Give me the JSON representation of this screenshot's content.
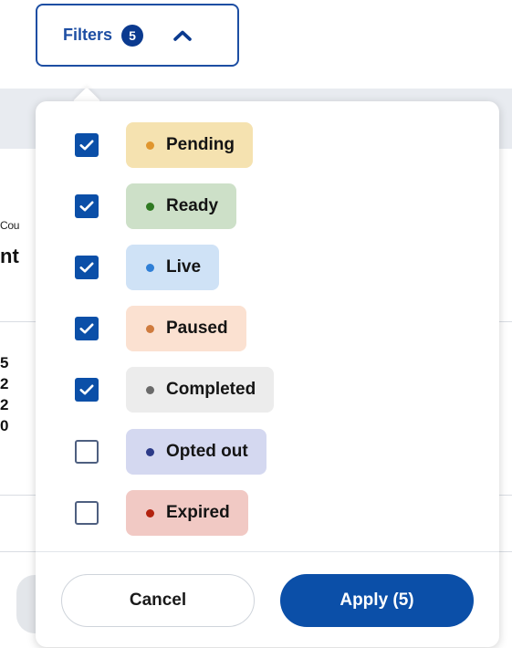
{
  "background": {
    "small_text": "Cou",
    "heading": "nt",
    "numbers": [
      "5",
      "2",
      "2",
      "0"
    ]
  },
  "filters_button": {
    "label": "Filters",
    "count": "5",
    "icon": "chevron-up-icon"
  },
  "options": [
    {
      "label": "Pending",
      "checked": true,
      "chip_color": "#f5e2b0",
      "dot_color": "#e0962e"
    },
    {
      "label": "Ready",
      "checked": true,
      "chip_color": "#cde0c8",
      "dot_color": "#2f7a22"
    },
    {
      "label": "Live",
      "checked": true,
      "chip_color": "#cfe2f6",
      "dot_color": "#2f7fd6"
    },
    {
      "label": "Paused",
      "checked": true,
      "chip_color": "#fbe1d1",
      "dot_color": "#cf7b3e"
    },
    {
      "label": "Completed",
      "checked": true,
      "chip_color": "#ececec",
      "dot_color": "#6a6a6a"
    },
    {
      "label": "Opted out",
      "checked": false,
      "chip_color": "#d4d8f0",
      "dot_color": "#2c3a88"
    },
    {
      "label": "Expired",
      "checked": false,
      "chip_color": "#f1c9c4",
      "dot_color": "#b3220f"
    }
  ],
  "actions": {
    "cancel_label": "Cancel",
    "apply_label": "Apply (5)"
  },
  "colors": {
    "primary": "#0b4fa8",
    "outline": "#1d4ea3"
  }
}
